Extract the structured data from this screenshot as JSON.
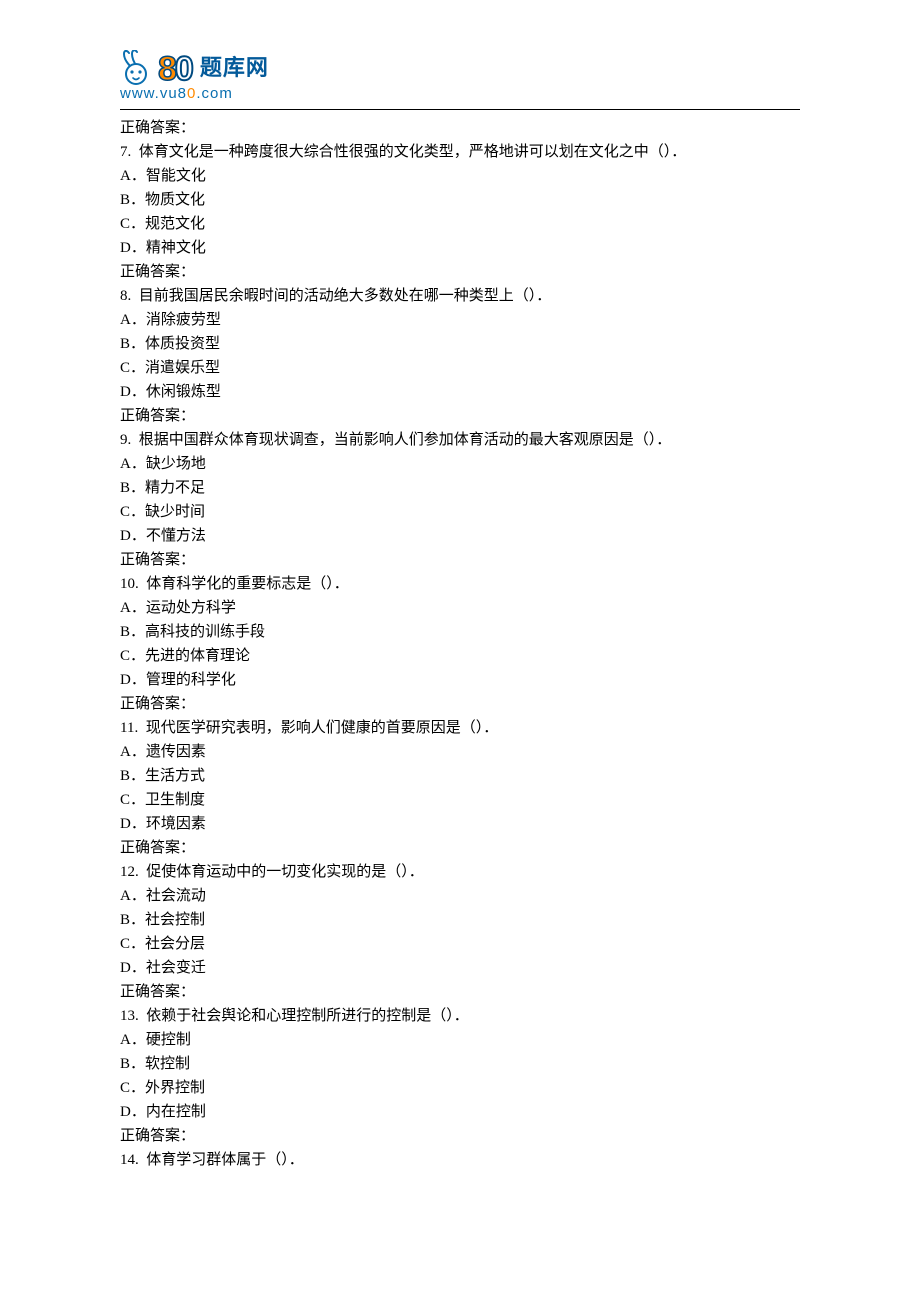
{
  "header": {
    "brand_cn": "题库网",
    "brand_url_prefix": "www.vu8",
    "brand_url_o": "0",
    "brand_url_suffix": ".com"
  },
  "lead_answer": "正确答案：",
  "questions": [
    {
      "num": "7. ",
      "stem": "体育文化是一种跨度很大综合性很强的文化类型，严格地讲可以划在文化之中（）．",
      "options": [
        "A．智能文化",
        "B．物质文化",
        "C．规范文化",
        "D．精神文化"
      ],
      "answer": "正确答案："
    },
    {
      "num": "8. ",
      "stem": "目前我国居民余暇时间的活动绝大多数处在哪一种类型上（）．",
      "options": [
        "A．消除疲劳型",
        "B．体质投资型",
        "C．消遣娱乐型",
        "D．休闲锻炼型"
      ],
      "answer": "正确答案："
    },
    {
      "num": "9. ",
      "stem": "根据中国群众体育现状调查，当前影响人们参加体育活动的最大客观原因是（）．",
      "options": [
        "A．缺少场地",
        "B．精力不足",
        "C．缺少时间",
        "D．不懂方法"
      ],
      "answer": "正确答案："
    },
    {
      "num": "10. ",
      "stem": "体育科学化的重要标志是（）．",
      "options": [
        "A．运动处方科学",
        "B．高科技的训练手段",
        "C．先进的体育理论",
        "D．管理的科学化"
      ],
      "answer": "正确答案："
    },
    {
      "num": "11. ",
      "stem": "现代医学研究表明，影响人们健康的首要原因是（）．",
      "options": [
        "A．遗传因素",
        "B．生活方式",
        "C．卫生制度",
        "D．环境因素"
      ],
      "answer": "正确答案："
    },
    {
      "num": "12. ",
      "stem": "促使体育运动中的一切变化实现的是（）．",
      "options": [
        "A．社会流动",
        "B．社会控制",
        "C．社会分层",
        "D．社会变迁"
      ],
      "answer": "正确答案："
    },
    {
      "num": "13. ",
      "stem": "依赖于社会舆论和心理控制所进行的控制是（）．",
      "options": [
        "A．硬控制",
        "B．软控制",
        "C．外界控制",
        "D．内在控制"
      ],
      "answer": "正确答案："
    },
    {
      "num": "14. ",
      "stem": "体育学习群体属于（）．",
      "options": [],
      "answer": null
    }
  ]
}
